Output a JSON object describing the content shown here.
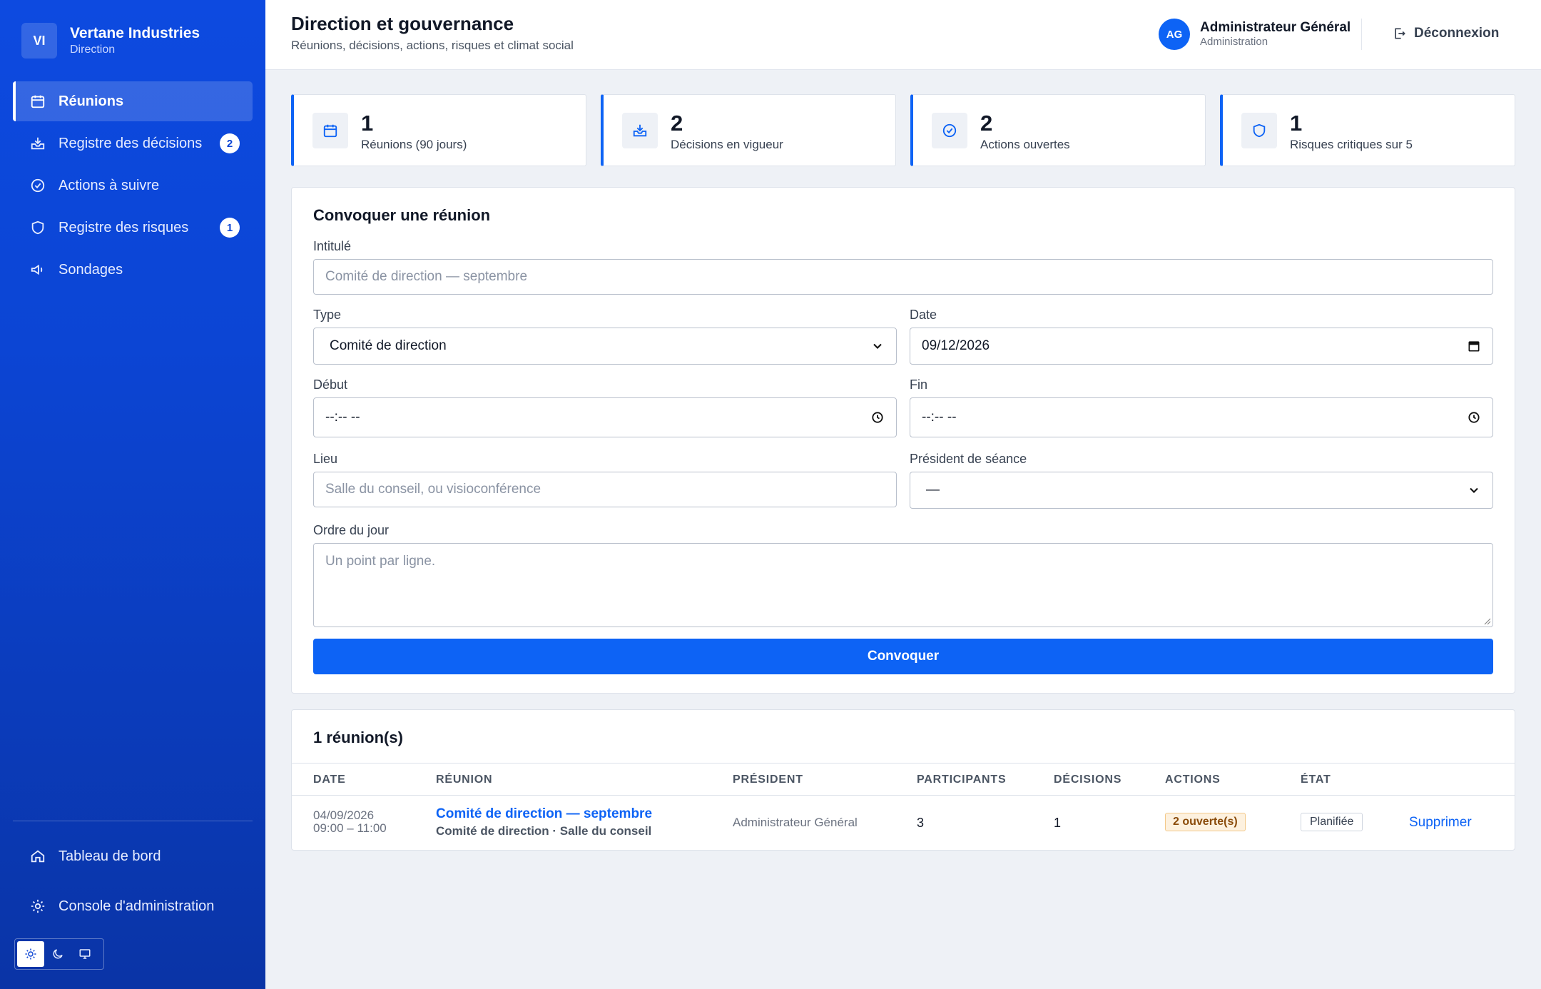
{
  "brand": {
    "initials": "VI",
    "name": "Vertane Industries",
    "subtitle": "Direction"
  },
  "sidebar": {
    "items": [
      {
        "label": "Réunions",
        "icon": "calendar-icon",
        "active": true
      },
      {
        "label": "Registre des décisions",
        "icon": "inbox-icon",
        "badge": "2"
      },
      {
        "label": "Actions à suivre",
        "icon": "check-circle-icon"
      },
      {
        "label": "Registre des risques",
        "icon": "shield-icon",
        "badge": "1"
      },
      {
        "label": "Sondages",
        "icon": "megaphone-icon"
      }
    ],
    "bottom": [
      {
        "label": "Tableau de bord",
        "icon": "home-icon"
      },
      {
        "label": "Console d'administration",
        "icon": "gear-icon"
      }
    ],
    "theme_options": [
      "sun-icon",
      "moon-icon",
      "monitor-icon"
    ]
  },
  "header": {
    "title": "Direction et gouvernance",
    "subtitle": "Réunions, décisions, actions, risques et climat social",
    "user": {
      "initials": "AG",
      "name": "Administrateur Général",
      "role": "Administration"
    },
    "logout_label": "Déconnexion"
  },
  "stats": [
    {
      "value": "1",
      "label": "Réunions (90 jours)",
      "icon": "calendar-icon"
    },
    {
      "value": "2",
      "label": "Décisions en vigueur",
      "icon": "inbox-icon"
    },
    {
      "value": "2",
      "label": "Actions ouvertes",
      "icon": "check-circle-icon"
    },
    {
      "value": "1",
      "label": "Risques critiques sur 5",
      "icon": "shield-icon"
    }
  ],
  "form": {
    "title": "Convoquer une réunion",
    "intitule": {
      "label": "Intitulé",
      "placeholder": "Comité de direction — septembre"
    },
    "type": {
      "label": "Type",
      "value": "Comité de direction"
    },
    "date": {
      "label": "Date",
      "value": "09/12/2026"
    },
    "debut": {
      "label": "Début",
      "value": "--:-- --"
    },
    "fin": {
      "label": "Fin",
      "value": "--:-- --"
    },
    "lieu": {
      "label": "Lieu",
      "placeholder": "Salle du conseil, ou visioconférence"
    },
    "president": {
      "label": "Président de séance",
      "value": "—"
    },
    "ordre": {
      "label": "Ordre du jour",
      "placeholder": "Un point par ligne."
    },
    "submit_label": "Convoquer"
  },
  "table": {
    "title": "1 réunion(s)",
    "columns": [
      "DATE",
      "RÉUNION",
      "PRÉSIDENT",
      "PARTICIPANTS",
      "DÉCISIONS",
      "ACTIONS",
      "ÉTAT"
    ],
    "rows": [
      {
        "date": "04/09/2026",
        "time": "09:00 – 11:00",
        "title": "Comité de direction — septembre",
        "details": "Comité de direction · Salle du conseil",
        "president": "Administrateur Général",
        "participants": "3",
        "decisions": "1",
        "actions": "2 ouverte(s)",
        "etat": "Planifiée",
        "delete_label": "Supprimer"
      }
    ]
  },
  "colors": {
    "sidebar": "#0c45d4",
    "accent": "#0d63f5",
    "background": "#eef1f6"
  }
}
